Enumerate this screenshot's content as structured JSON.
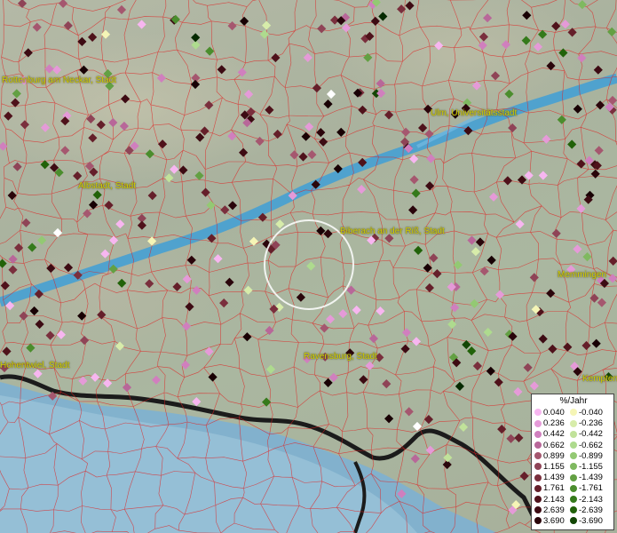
{
  "map": {
    "place_labels": [
      {
        "name": "Rottenburg am Neckar, Stadt"
      },
      {
        "name": "Ulm, Universitätsstadt"
      },
      {
        "name": "Albstadt, Stadt"
      },
      {
        "name": "Biberach an der Riß, Stadt"
      },
      {
        "name": "Memmingen"
      },
      {
        "name": "Hohentwiel, Stadt"
      },
      {
        "name": "Ravensburg, Stadt"
      },
      {
        "name": "Kempten"
      }
    ],
    "colors": {
      "positive": [
        "#f7b6f0",
        "#e59ad8",
        "#d07fbe",
        "#b86799",
        "#a5576f",
        "#8f4457",
        "#7a2f3d",
        "#651f2a",
        "#4f121b",
        "#3d0b13",
        "#2a050b",
        "#180004"
      ],
      "negative": [
        "#f5f5b6",
        "#d7ecaa",
        "#c1e29a",
        "#aedb8e",
        "#93c973",
        "#7fb960",
        "#63a043",
        "#4b8d2d",
        "#357a1b",
        "#216209",
        "#124605",
        "#062a01"
      ],
      "boundary": "#e02020",
      "river": "#3f9fd6",
      "lake": "#7fb1d0"
    }
  },
  "legend": {
    "title": "%/Jahr",
    "positive": [
      "0.040",
      "0.236",
      "0.442",
      "0.662",
      "0.899",
      "1.155",
      "1.439",
      "1.761",
      "2.143",
      "2.639",
      "3.690"
    ],
    "negative": [
      "-0.040",
      "-0.236",
      "-0.442",
      "-0.662",
      "-0.899",
      "-1.155",
      "-1.439",
      "-1.761",
      "-2.143",
      "-2.639",
      "-3.690"
    ]
  }
}
